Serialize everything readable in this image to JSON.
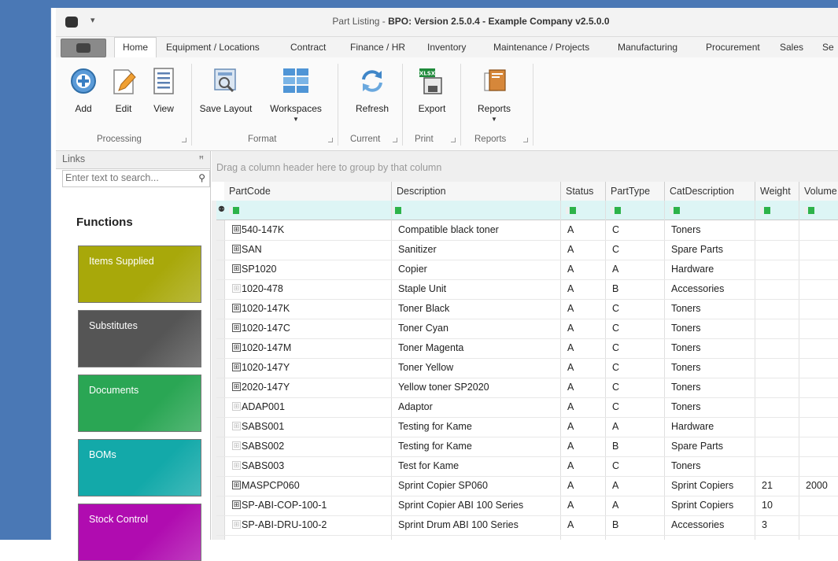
{
  "window": {
    "title_prefix": "Part Listing - ",
    "title_bold": "BPO: Version 2.5.0.4 - Example Company v2.5.0.0",
    "qat_glyph": "▾"
  },
  "tabs": [
    "Home",
    "Equipment / Locations",
    "Contract",
    "Finance / HR",
    "Inventory",
    "Maintenance / Projects",
    "Manufacturing",
    "Procurement",
    "Sales",
    "Se"
  ],
  "ribbon": {
    "add": "Add",
    "edit": "Edit",
    "view": "View",
    "save_layout": "Save Layout",
    "workspaces": "Workspaces",
    "refresh": "Refresh",
    "export": "Export",
    "reports": "Reports",
    "export_badge": "XLSX",
    "dropdown_glyph": "▼",
    "groups": {
      "processing": "Processing",
      "format": "Format",
      "current": "Current",
      "print": "Print",
      "reports": "Reports"
    }
  },
  "links": {
    "title": "Links",
    "pin_glyph": "ꟸ",
    "search_placeholder": "Enter text to search...",
    "search_glyph": "⚲",
    "functions_title": "Functions",
    "tiles": [
      {
        "label": "Items Supplied",
        "color": "#a8a80a"
      },
      {
        "label": "Substitutes",
        "color": "#555555"
      },
      {
        "label": "Documents",
        "color": "#2aa654"
      },
      {
        "label": "BOMs",
        "color": "#13a9a9"
      },
      {
        "label": "Stock Control",
        "color": "#b00cb0"
      }
    ]
  },
  "grid": {
    "group_hint": "Drag a column header here to group by that column",
    "filter_glyph": "⚉",
    "columns": [
      "PartCode",
      "Description",
      "Status",
      "PartType",
      "CatDescription",
      "Weight",
      "Volume"
    ],
    "rows": [
      {
        "code": "540-147K",
        "exp": "⊞",
        "desc": "Compatible black toner",
        "status": "A",
        "type": "C",
        "cat": "Toners",
        "weight": "",
        "volume": ""
      },
      {
        "code": "SAN",
        "exp": "⊞",
        "desc": "Sanitizer",
        "status": "A",
        "type": "C",
        "cat": "Spare Parts",
        "weight": "",
        "volume": ""
      },
      {
        "code": "SP1020",
        "exp": "⊞",
        "desc": "Copier",
        "status": "A",
        "type": "A",
        "cat": "Hardware",
        "weight": "",
        "volume": ""
      },
      {
        "code": "1020-478",
        "exp": "⊞",
        "desc": "Staple Unit",
        "status": "A",
        "type": "B",
        "cat": "Accessories",
        "weight": "",
        "volume": ""
      },
      {
        "code": "1020-147K",
        "exp": "⊞",
        "desc": "Toner Black",
        "status": "A",
        "type": "C",
        "cat": "Toners",
        "weight": "",
        "volume": ""
      },
      {
        "code": "1020-147C",
        "exp": "⊞",
        "desc": "Toner Cyan",
        "status": "A",
        "type": "C",
        "cat": "Toners",
        "weight": "",
        "volume": ""
      },
      {
        "code": "1020-147M",
        "exp": "⊞",
        "desc": "Toner Magenta",
        "status": "A",
        "type": "C",
        "cat": "Toners",
        "weight": "",
        "volume": ""
      },
      {
        "code": "1020-147Y",
        "exp": "⊞",
        "desc": "Toner Yellow",
        "status": "A",
        "type": "C",
        "cat": "Toners",
        "weight": "",
        "volume": ""
      },
      {
        "code": "2020-147Y",
        "exp": "⊞",
        "desc": "Yellow toner SP2020",
        "status": "A",
        "type": "C",
        "cat": "Toners",
        "weight": "",
        "volume": ""
      },
      {
        "code": "ADAP001",
        "exp": "⊞",
        "desc": "Adaptor",
        "status": "A",
        "type": "C",
        "cat": "Toners",
        "weight": "",
        "volume": ""
      },
      {
        "code": "SABS001",
        "exp": "⊞",
        "desc": "Testing for Kame",
        "status": "A",
        "type": "A",
        "cat": "Hardware",
        "weight": "",
        "volume": ""
      },
      {
        "code": "SABS002",
        "exp": "⊞",
        "desc": "Testing for Kame",
        "status": "A",
        "type": "B",
        "cat": "Spare Parts",
        "weight": "",
        "volume": ""
      },
      {
        "code": "SABS003",
        "exp": "⊞",
        "desc": "Test for Kame",
        "status": "A",
        "type": "C",
        "cat": "Toners",
        "weight": "",
        "volume": ""
      },
      {
        "code": "MASPCP060",
        "exp": "⊞",
        "desc": "Sprint Copier SP060",
        "status": "A",
        "type": "A",
        "cat": "Sprint Copiers",
        "weight": "21",
        "volume": "2000"
      },
      {
        "code": "SP-ABI-COP-100-1",
        "exp": "⊞",
        "desc": "Sprint Copier ABI 100 Series",
        "status": "A",
        "type": "A",
        "cat": "Sprint Copiers",
        "weight": "10",
        "volume": ""
      },
      {
        "code": "SP-ABI-DRU-100-2",
        "exp": "⊞",
        "desc": "Sprint Drum ABI 100 Series",
        "status": "A",
        "type": "B",
        "cat": "Accessories",
        "weight": "3",
        "volume": ""
      }
    ]
  }
}
